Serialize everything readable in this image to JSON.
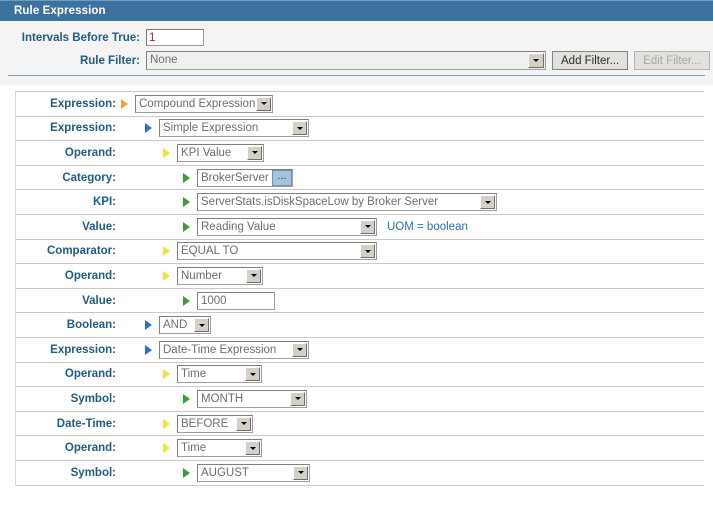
{
  "window": {
    "title": "Rule Expression"
  },
  "topform": {
    "intervals_label": "Intervals Before True:",
    "intervals_value": "1",
    "rule_filter_label": "Rule Filter:",
    "rule_filter_value": "None",
    "add_filter_button": "Add Filter...",
    "edit_filter_button": "Edit Filter..."
  },
  "colors": {
    "titlebar": "#3d719f",
    "label_text": "#1f5e82",
    "tri_orange": "#f0a030",
    "tri_blue": "#2a6fd4",
    "tri_yellow": "#f5e13c",
    "tri_green": "#3b9b3b",
    "uom_text": "#2a6fb5",
    "input_value": "#7b2f6e"
  },
  "rows": [
    {
      "label": "Expression:",
      "value": "Compound Expression",
      "marker": "orange",
      "indent": 0,
      "widget": "combo"
    },
    {
      "label": "Expression:",
      "value": "Simple Expression",
      "marker": "blue",
      "indent": 1,
      "widget": "combo"
    },
    {
      "label": "Operand:",
      "value": "KPI Value",
      "marker": "yellow",
      "indent": 2,
      "widget": "combo"
    },
    {
      "label": "Category:",
      "value": "BrokerServer",
      "marker": "green",
      "indent": 3,
      "widget": "browse",
      "browse_label": "..."
    },
    {
      "label": "KPI:",
      "value": "ServerStats.isDiskSpaceLow by Broker Server",
      "marker": "green",
      "indent": 3,
      "widget": "combo"
    },
    {
      "label": "Value:",
      "value": "Reading Value",
      "marker": "green",
      "indent": 3,
      "widget": "combo",
      "suffix": "UOM = boolean"
    },
    {
      "label": "Comparator:",
      "value": "EQUAL TO",
      "marker": "yellow",
      "indent": 2,
      "widget": "combo"
    },
    {
      "label": "Operand:",
      "value": "Number",
      "marker": "yellow",
      "indent": 2,
      "widget": "combo"
    },
    {
      "label": "Value:",
      "value": "1000",
      "marker": "green",
      "indent": 3,
      "widget": "text"
    },
    {
      "label": "Boolean:",
      "value": "AND",
      "marker": "blue",
      "indent": 1,
      "widget": "combo"
    },
    {
      "label": "Expression:",
      "value": "Date-Time Expression",
      "marker": "blue",
      "indent": 1,
      "widget": "combo"
    },
    {
      "label": "Operand:",
      "value": "Time",
      "marker": "yellow",
      "indent": 2,
      "widget": "combo"
    },
    {
      "label": "Symbol:",
      "value": "MONTH",
      "marker": "green",
      "indent": 3,
      "widget": "combo"
    },
    {
      "label": "Date-Time:",
      "value": "BEFORE",
      "marker": "yellow",
      "indent": 2,
      "widget": "combo"
    },
    {
      "label": "Operand:",
      "value": "Time",
      "marker": "yellow",
      "indent": 2,
      "widget": "combo"
    },
    {
      "label": "Symbol:",
      "value": "AUGUST",
      "marker": "green",
      "indent": 3,
      "widget": "combo"
    }
  ],
  "icons": {
    "dropdown": "chevron-down-icon",
    "expander": "expander-triangle-icon",
    "browse": "ellipsis-browse-icon"
  }
}
